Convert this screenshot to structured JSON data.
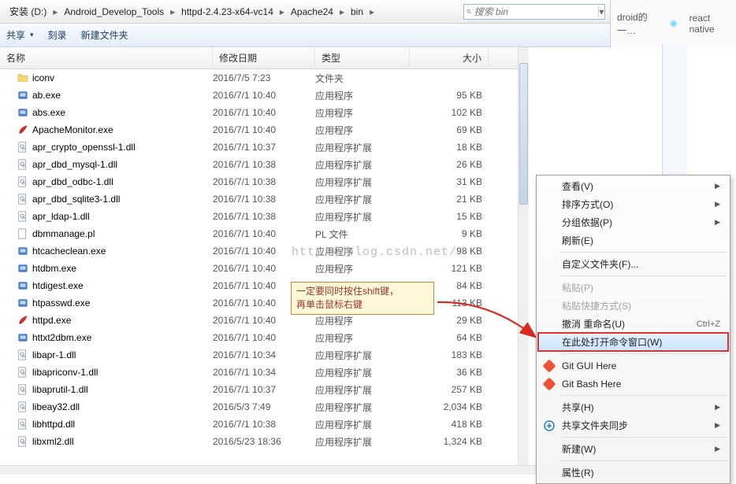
{
  "breadcrumb": {
    "items": [
      "安装 (D:)",
      "Android_Develop_Tools",
      "httpd-2.4.23-x64-vc14",
      "Apache24",
      "bin"
    ],
    "search_placeholder": "搜索 bin"
  },
  "toolbar": {
    "share": "共享",
    "burn": "刻录",
    "newfolder": "新建文件夹"
  },
  "columns": {
    "name": "名称",
    "date": "修改日期",
    "type": "类型",
    "size": "大小"
  },
  "files": [
    {
      "icon": "folder",
      "name": "iconv",
      "date": "2016/7/5 7:23",
      "type": "文件夹",
      "size": ""
    },
    {
      "icon": "exe",
      "name": "ab.exe",
      "date": "2016/7/1 10:40",
      "type": "应用程序",
      "size": "95 KB"
    },
    {
      "icon": "exe",
      "name": "abs.exe",
      "date": "2016/7/1 10:40",
      "type": "应用程序",
      "size": "102 KB"
    },
    {
      "icon": "feather",
      "name": "ApacheMonitor.exe",
      "date": "2016/7/1 10:40",
      "type": "应用程序",
      "size": "69 KB"
    },
    {
      "icon": "dll",
      "name": "apr_crypto_openssl-1.dll",
      "date": "2016/7/1 10:37",
      "type": "应用程序扩展",
      "size": "18 KB"
    },
    {
      "icon": "dll",
      "name": "apr_dbd_mysql-1.dll",
      "date": "2016/7/1 10:38",
      "type": "应用程序扩展",
      "size": "26 KB"
    },
    {
      "icon": "dll",
      "name": "apr_dbd_odbc-1.dll",
      "date": "2016/7/1 10:38",
      "type": "应用程序扩展",
      "size": "31 KB"
    },
    {
      "icon": "dll",
      "name": "apr_dbd_sqlite3-1.dll",
      "date": "2016/7/1 10:38",
      "type": "应用程序扩展",
      "size": "21 KB"
    },
    {
      "icon": "dll",
      "name": "apr_ldap-1.dll",
      "date": "2016/7/1 10:38",
      "type": "应用程序扩展",
      "size": "15 KB"
    },
    {
      "icon": "file",
      "name": "dbmmanage.pl",
      "date": "2016/7/1 10:40",
      "type": "PL 文件",
      "size": "9 KB"
    },
    {
      "icon": "exe",
      "name": "htcacheclean.exe",
      "date": "2016/7/1 10:40",
      "type": "应用程序",
      "size": "98 KB"
    },
    {
      "icon": "exe",
      "name": "htdbm.exe",
      "date": "2016/7/1 10:40",
      "type": "应用程序",
      "size": "121 KB"
    },
    {
      "icon": "exe",
      "name": "htdigest.exe",
      "date": "2016/7/1 10:40",
      "type": "应用程序",
      "size": "84 KB"
    },
    {
      "icon": "exe",
      "name": "htpasswd.exe",
      "date": "2016/7/1 10:40",
      "type": "应用程序",
      "size": "113 KB"
    },
    {
      "icon": "feather",
      "name": "httpd.exe",
      "date": "2016/7/1 10:40",
      "type": "应用程序",
      "size": "29 KB"
    },
    {
      "icon": "exe",
      "name": "httxt2dbm.exe",
      "date": "2016/7/1 10:40",
      "type": "应用程序",
      "size": "64 KB"
    },
    {
      "icon": "dll",
      "name": "libapr-1.dll",
      "date": "2016/7/1 10:34",
      "type": "应用程序扩展",
      "size": "183 KB"
    },
    {
      "icon": "dll",
      "name": "libapriconv-1.dll",
      "date": "2016/7/1 10:34",
      "type": "应用程序扩展",
      "size": "36 KB"
    },
    {
      "icon": "dll",
      "name": "libaprutil-1.dll",
      "date": "2016/7/1 10:37",
      "type": "应用程序扩展",
      "size": "257 KB"
    },
    {
      "icon": "dll",
      "name": "libeay32.dll",
      "date": "2016/5/3 7:49",
      "type": "应用程序扩展",
      "size": "2,034 KB"
    },
    {
      "icon": "dll",
      "name": "libhttpd.dll",
      "date": "2016/7/1 10:38",
      "type": "应用程序扩展",
      "size": "418 KB"
    },
    {
      "icon": "dll",
      "name": "libxml2.dll",
      "date": "2016/5/23 18:36",
      "type": "应用程序扩展",
      "size": "1,324 KB"
    }
  ],
  "watermark": "http://blog.csdn.net/",
  "callout": {
    "line1": "一定要同时按住shift键，",
    "line2": "再单击鼠标右键"
  },
  "context_menu": {
    "view": "查看(V)",
    "sort": "排序方式(O)",
    "group": "分组依据(P)",
    "refresh": "刷新(E)",
    "customize": "自定义文件夹(F)...",
    "paste": "粘贴(P)",
    "paste_shortcut": "粘贴快捷方式(S)",
    "undo": "撤消 重命名(U)",
    "undo_sc": "Ctrl+Z",
    "open_cmd": "在此处打开命令窗口(W)",
    "git_gui": "Git GUI Here",
    "git_bash": "Git Bash Here",
    "share": "共享(H)",
    "sync": "共享文件夹同步",
    "new": "新建(W)",
    "properties": "属性(R)"
  },
  "browser_tabs": {
    "tab1": "droid的一…",
    "tab2": "react native"
  }
}
